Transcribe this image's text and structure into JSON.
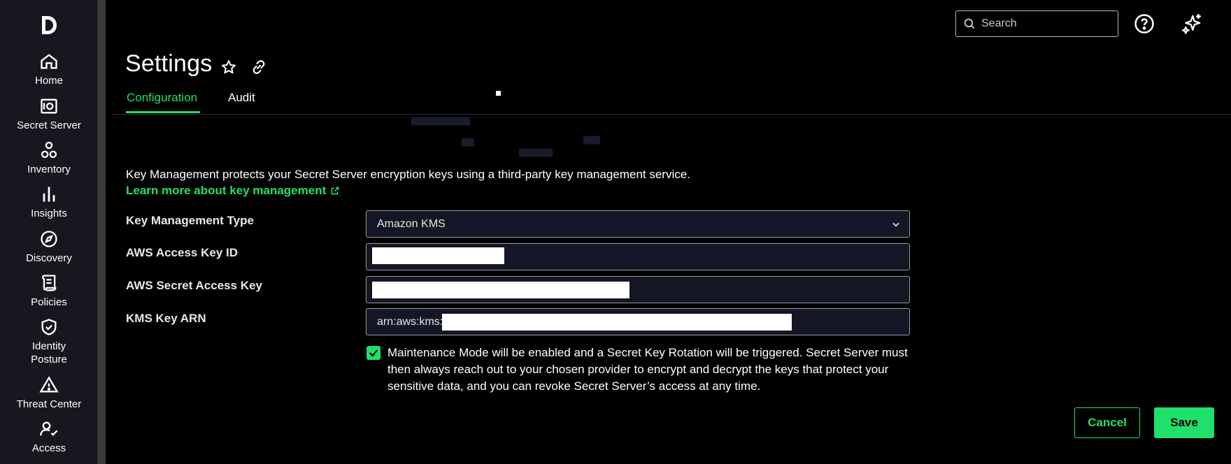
{
  "nav": {
    "logo": "D",
    "items": [
      {
        "label": "Home",
        "icon": "home-icon"
      },
      {
        "label": "Secret Server",
        "icon": "safe-icon"
      },
      {
        "label": "Inventory",
        "icon": "inventory-icon"
      },
      {
        "label": "Insights",
        "icon": "bar-chart-icon"
      },
      {
        "label": "Discovery",
        "icon": "compass-icon"
      },
      {
        "label": "Policies",
        "icon": "scroll-icon"
      },
      {
        "label": "Identity Posture",
        "icon": "shield-check-icon"
      },
      {
        "label": "Threat Center",
        "icon": "warning-icon"
      },
      {
        "label": "Access",
        "icon": "user-check-icon"
      }
    ]
  },
  "topbar": {
    "search_placeholder": "Search",
    "help_icon": "help-icon",
    "ai_icon": "sparkle-icon"
  },
  "header": {
    "title": "Settings",
    "tabs": [
      {
        "label": "Configuration",
        "active": true
      },
      {
        "label": "Audit",
        "active": false
      }
    ]
  },
  "main": {
    "description": "Key Management protects your Secret Server encryption keys using a third-party key management service.",
    "learn_more": "Learn more about key management",
    "fields": [
      {
        "label": "Key Management Type",
        "value": "Amazon KMS",
        "type": "select"
      },
      {
        "label": "AWS Access Key ID",
        "value": "",
        "type": "text"
      },
      {
        "label": "AWS Secret Access Key",
        "value": "",
        "type": "text"
      },
      {
        "label": "KMS Key ARN",
        "value": "arn:aws:kms:",
        "type": "text"
      }
    ],
    "maintenance_checked": true,
    "maintenance_text": "Maintenance Mode will be enabled and a Secret Key Rotation will be triggered. Secret Server must then always reach out to your chosen provider to encrypt and decrypt the keys that protect your sensitive data, and you can revoke Secret Server’s access at any time."
  },
  "actions": {
    "cancel": "Cancel",
    "save": "Save"
  },
  "colors": {
    "accent": "#1fe06b",
    "nav_bg": "#16171f",
    "field_bg": "#141625"
  }
}
